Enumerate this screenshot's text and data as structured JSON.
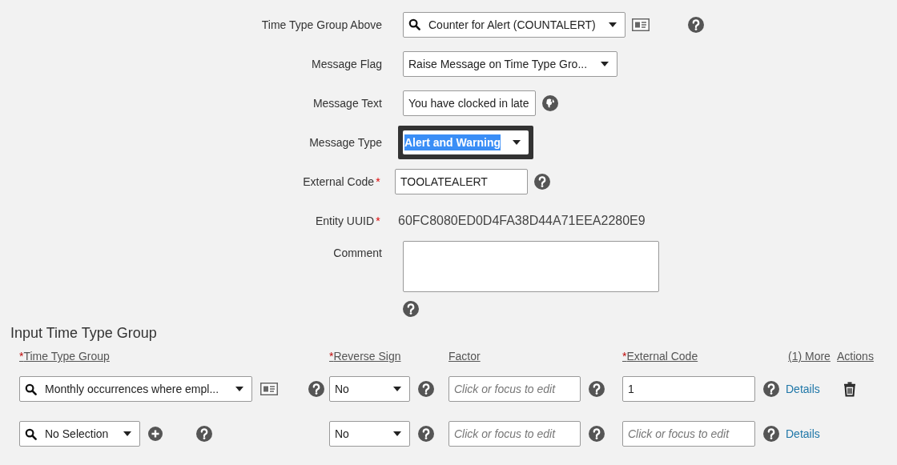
{
  "form": {
    "fields": [
      {
        "label": "Time Type Group Above",
        "kind": "lookup",
        "value": "Counter for Alert (COUNTALERT)"
      },
      {
        "label": "Message Flag",
        "kind": "select",
        "value": "Raise Message on Time Type Gro..."
      },
      {
        "label": "Message Text",
        "kind": "translatable",
        "value": "You have clocked in late"
      },
      {
        "label": "Message Type",
        "kind": "select",
        "value": "Alert and Warning",
        "focused": true
      },
      {
        "label": "External Code",
        "required_mark": "*",
        "kind": "text",
        "value": "TOOLATEALERT"
      },
      {
        "label": "Entity UUID",
        "required_mark": "*",
        "kind": "readonly",
        "value": "60FC8080ED0D4FA38D44A71EEA2280E9"
      },
      {
        "label": "Comment",
        "kind": "textarea"
      }
    ]
  },
  "input_section": {
    "title": "Input Time Type Group",
    "columns": [
      {
        "label": "Time Type Group",
        "required_mark": "*"
      },
      {
        "label": "Reverse Sign",
        "required_mark": "*"
      },
      {
        "label": "Factor"
      },
      {
        "label": "External Code",
        "required_mark": "*"
      },
      {
        "label": "(1) More"
      },
      {
        "label": "Actions"
      }
    ],
    "rows": [
      {
        "kind": "existing",
        "time_type_group": "Monthly occurrences where empl...",
        "reverse_sign": "No",
        "factor": {
          "placeholder": "Click or focus to edit"
        },
        "external_code": {
          "value": "1"
        },
        "details_link": "Details",
        "deletable": true
      },
      {
        "kind": "new",
        "time_type_group": "No Selection",
        "reverse_sign": "No",
        "factor": {
          "placeholder": "Click or focus to edit"
        },
        "external_code": {
          "placeholder": "Click or focus to edit"
        },
        "details_link": "Details",
        "deletable": false
      }
    ]
  }
}
